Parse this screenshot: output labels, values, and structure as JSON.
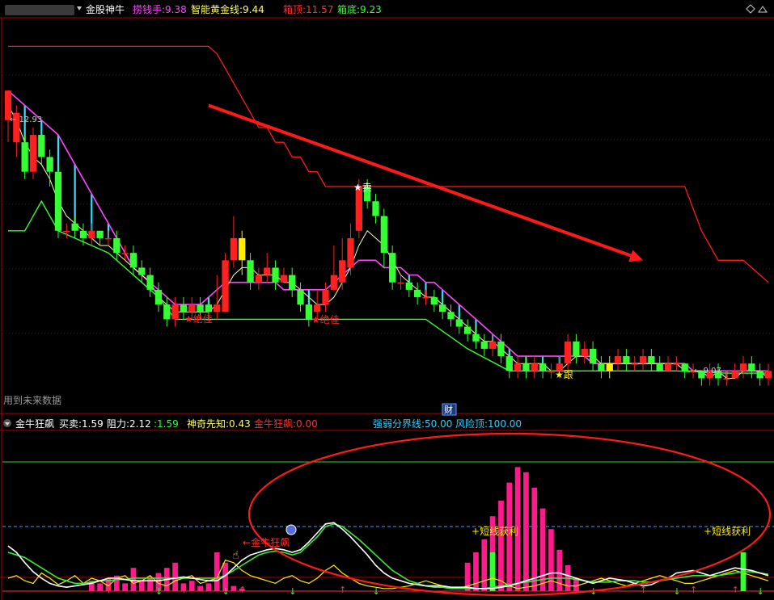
{
  "header": {
    "title": "金股神牛",
    "indicators": [
      {
        "label": "捞钱手:",
        "value": "9.38",
        "color": "#ff44ff"
      },
      {
        "label": "智能黄金线:",
        "value": "9.44",
        "color": "#ffff66"
      },
      {
        "label": "箱顶:",
        "value": "11.57",
        "color": "#ff3030"
      },
      {
        "label": "箱底:",
        "value": "9.23",
        "color": "#33ff33"
      }
    ]
  },
  "main_panel": {
    "high_marker": "12.93",
    "low_marker": "9.07",
    "signals": [
      {
        "text": "★绝佳",
        "color": "#ff2020"
      },
      {
        "text": "★绝佳",
        "color": "#ff2020"
      },
      {
        "text": "★卖",
        "color": "#ffffff"
      },
      {
        "text": "★跟",
        "color": "#ffee00"
      }
    ],
    "future_data_note": "用到未来数据",
    "cai_badge": "财"
  },
  "sub_header": {
    "title": "金牛狂飙",
    "indicators": [
      {
        "label": "买卖:",
        "value": "1.59",
        "color": "#ffffff"
      },
      {
        "label": "阻力:",
        "value": "2.12",
        "color": "#ffffff"
      },
      {
        "label": ":",
        "value": "1.59",
        "color": "#33ff33"
      },
      {
        "label": "神奇先知:",
        "value": "0.43",
        "color": "#ffff66"
      },
      {
        "label": "金牛狂飙:",
        "value": "0.00",
        "color": "#ff3030"
      },
      {
        "label": "强弱分界线:",
        "value": "50.00",
        "color": "#33ccff"
      },
      {
        "label": "风险顶:",
        "value": "100.00",
        "color": "#33ccff"
      }
    ]
  },
  "sub_panel": {
    "labels": [
      {
        "text": "短线获利",
        "color": "#ffee00"
      },
      {
        "text": "短线获利",
        "color": "#ffee00"
      },
      {
        "text": "金牛狂飙",
        "color": "#ff3030"
      }
    ]
  },
  "chart_data": {
    "type": "candlestick",
    "ylim": [
      8.6,
      13.8
    ],
    "candles": [
      [
        12.5,
        12.9,
        12.9,
        12.2
      ],
      [
        12.2,
        12.6,
        12.7,
        12.0
      ],
      [
        12.2,
        11.8,
        12.3,
        11.7
      ],
      [
        11.8,
        12.3,
        12.4,
        11.7
      ],
      [
        12.3,
        12.0,
        12.4,
        11.9
      ],
      [
        12.0,
        11.8,
        12.1,
        11.6
      ],
      [
        11.8,
        11.0,
        11.9,
        10.9
      ],
      [
        11.0,
        11.0,
        11.1,
        10.9
      ],
      [
        11.1,
        11.0,
        11.2,
        10.9
      ],
      [
        11.0,
        10.9,
        11.1,
        10.8
      ],
      [
        10.9,
        11.0,
        11.1,
        10.8
      ],
      [
        11.0,
        10.9,
        11.0,
        10.8
      ],
      [
        10.9,
        10.9,
        11.0,
        10.8
      ],
      [
        10.9,
        10.7,
        11.0,
        10.6
      ],
      [
        10.7,
        10.7,
        10.8,
        10.6
      ],
      [
        10.7,
        10.5,
        10.8,
        10.4
      ],
      [
        10.5,
        10.4,
        10.6,
        10.3
      ],
      [
        10.4,
        10.2,
        10.5,
        10.1
      ],
      [
        10.2,
        10.0,
        10.3,
        9.9
      ],
      [
        10.0,
        9.8,
        10.1,
        9.7
      ],
      [
        9.8,
        10.0,
        10.1,
        9.7
      ],
      [
        10.0,
        9.9,
        10.1,
        9.8
      ],
      [
        9.9,
        10.0,
        10.1,
        9.8
      ],
      [
        10.0,
        9.9,
        10.1,
        9.8
      ],
      [
        10.0,
        9.9,
        10.1,
        9.8
      ],
      [
        9.9,
        10.0,
        10.4,
        9.8
      ],
      [
        9.9,
        10.6,
        10.7,
        9.9
      ],
      [
        10.6,
        10.9,
        11.2,
        10.5
      ],
      [
        10.9,
        10.6,
        11.0,
        10.4
      ],
      [
        10.6,
        10.3,
        10.7,
        10.2
      ],
      [
        10.3,
        10.4,
        10.5,
        10.2
      ],
      [
        10.4,
        10.5,
        10.7,
        10.3
      ],
      [
        10.5,
        10.3,
        10.6,
        10.2
      ],
      [
        10.3,
        10.4,
        10.5,
        10.3
      ],
      [
        10.4,
        10.2,
        10.5,
        10.1
      ],
      [
        10.2,
        10.0,
        10.3,
        9.9
      ],
      [
        10.0,
        9.8,
        10.1,
        9.7
      ],
      [
        9.9,
        10.0,
        10.2,
        9.8
      ],
      [
        10.0,
        10.2,
        10.3,
        9.9
      ],
      [
        10.2,
        10.4,
        10.8,
        10.2
      ],
      [
        10.3,
        10.6,
        10.9,
        10.2
      ],
      [
        10.5,
        10.9,
        11.1,
        10.4
      ],
      [
        11.0,
        11.6,
        11.7,
        10.9
      ],
      [
        11.6,
        11.4,
        11.7,
        11.3
      ],
      [
        11.4,
        11.2,
        11.5,
        11.1
      ],
      [
        11.2,
        10.7,
        11.3,
        10.5
      ],
      [
        10.7,
        10.3,
        10.8,
        10.2
      ],
      [
        10.3,
        10.3,
        10.4,
        10.2
      ],
      [
        10.3,
        10.2,
        10.4,
        10.1
      ],
      [
        10.2,
        10.1,
        10.3,
        10.0
      ],
      [
        10.1,
        10.1,
        10.2,
        10.0
      ],
      [
        10.1,
        10.0,
        10.2,
        9.9
      ],
      [
        10.0,
        9.9,
        10.1,
        9.8
      ],
      [
        9.9,
        9.8,
        10.0,
        9.7
      ],
      [
        9.8,
        9.7,
        9.9,
        9.6
      ],
      [
        9.7,
        9.6,
        9.8,
        9.5
      ],
      [
        9.6,
        9.5,
        9.7,
        9.4
      ],
      [
        9.5,
        9.4,
        9.6,
        9.3
      ],
      [
        9.4,
        9.5,
        9.6,
        9.3
      ],
      [
        9.5,
        9.3,
        9.6,
        9.2
      ],
      [
        9.3,
        9.1,
        9.4,
        9.0
      ],
      [
        9.1,
        9.2,
        9.3,
        9.0
      ],
      [
        9.2,
        9.1,
        9.3,
        9.0
      ],
      [
        9.1,
        9.2,
        9.3,
        9.0
      ],
      [
        9.2,
        9.1,
        9.3,
        9.0
      ],
      [
        9.1,
        9.1,
        9.2,
        9.0
      ],
      [
        9.1,
        9.2,
        9.3,
        9.0
      ],
      [
        9.2,
        9.5,
        9.6,
        9.1
      ],
      [
        9.5,
        9.3,
        9.6,
        9.2
      ],
      [
        9.3,
        9.4,
        9.5,
        9.2
      ],
      [
        9.4,
        9.2,
        9.5,
        9.1
      ],
      [
        9.2,
        9.1,
        9.3,
        9.0
      ],
      [
        9.1,
        9.2,
        9.3,
        9.0
      ],
      [
        9.2,
        9.3,
        9.4,
        9.1
      ],
      [
        9.3,
        9.2,
        9.4,
        9.1
      ],
      [
        9.2,
        9.2,
        9.3,
        9.1
      ],
      [
        9.2,
        9.3,
        9.4,
        9.1
      ],
      [
        9.3,
        9.2,
        9.4,
        9.1
      ],
      [
        9.2,
        9.1,
        9.3,
        9.1
      ],
      [
        9.1,
        9.2,
        9.3,
        9.1
      ],
      [
        9.2,
        9.2,
        9.3,
        9.1
      ],
      [
        9.2,
        9.1,
        9.2,
        9.0
      ],
      [
        9.1,
        9.1,
        9.2,
        9.0
      ],
      [
        9.1,
        9.0,
        9.1,
        8.9
      ],
      [
        9.0,
        9.1,
        9.2,
        8.9
      ],
      [
        9.1,
        9.0,
        9.2,
        8.9
      ],
      [
        9.0,
        9.0,
        9.1,
        8.9
      ],
      [
        9.0,
        9.1,
        9.2,
        9.0
      ],
      [
        9.1,
        9.2,
        9.3,
        9.0
      ],
      [
        9.2,
        9.1,
        9.3,
        9.0
      ],
      [
        9.1,
        9.0,
        9.2,
        8.9
      ],
      [
        9.0,
        9.1,
        9.2,
        8.9
      ]
    ],
    "candle_colors": {
      "up": "#ff2020",
      "down": "#33ff33",
      "highlight": "#ffee00"
    },
    "box_top": [
      13.5,
      13.5,
      13.5,
      13.5,
      13.5,
      13.5,
      13.5,
      13.5,
      13.5,
      13.5,
      13.5,
      13.5,
      13.5,
      13.5,
      13.5,
      13.5,
      13.5,
      13.5,
      13.5,
      13.5,
      13.5,
      13.5,
      13.5,
      13.5,
      13.5,
      13.4,
      13.2,
      13.0,
      12.8,
      12.6,
      12.4,
      12.4,
      12.2,
      12.2,
      12.0,
      12.0,
      11.8,
      11.8,
      11.6,
      11.6,
      11.6,
      11.6,
      11.6,
      11.6,
      11.6,
      11.6,
      11.6,
      11.6,
      11.6,
      11.6,
      11.6,
      11.6,
      11.6,
      11.6,
      11.6,
      11.6,
      11.6,
      11.6,
      11.6,
      11.6,
      11.6,
      11.6,
      11.6,
      11.6,
      11.6,
      11.6,
      11.6,
      11.6,
      11.6,
      11.6,
      11.6,
      11.6,
      11.6,
      11.6,
      11.6,
      11.6,
      11.6,
      11.6,
      11.6,
      11.6,
      11.6,
      11.6,
      11.3,
      11.0,
      10.8,
      10.6,
      10.6,
      10.6,
      10.6,
      10.5,
      10.4,
      10.3
    ],
    "box_bottom_path": [
      [
        0,
        11.0
      ],
      [
        2,
        11.0
      ],
      [
        4,
        11.4
      ],
      [
        6,
        11.0
      ],
      [
        8,
        10.9
      ],
      [
        10,
        10.8
      ],
      [
        12,
        10.7
      ],
      [
        14,
        10.5
      ],
      [
        16,
        10.3
      ],
      [
        18,
        10.1
      ],
      [
        20,
        9.8
      ],
      [
        30,
        9.8
      ],
      [
        40,
        9.8
      ],
      [
        50,
        9.8
      ],
      [
        55,
        9.4
      ],
      [
        60,
        9.1
      ],
      [
        70,
        9.1
      ],
      [
        80,
        9.1
      ],
      [
        86,
        9.07
      ],
      [
        91,
        9.07
      ]
    ],
    "money_line": [
      12.9,
      12.8,
      12.7,
      12.6,
      12.5,
      12.4,
      12.3,
      12.1,
      11.9,
      11.7,
      11.5,
      11.3,
      11.1,
      10.9,
      10.7,
      10.5,
      10.4,
      10.3,
      10.2,
      10.1,
      10.0,
      10.0,
      10.0,
      10.0,
      10.1,
      10.2,
      10.3,
      10.3,
      10.3,
      10.3,
      10.3,
      10.3,
      10.3,
      10.2,
      10.2,
      10.2,
      10.2,
      10.2,
      10.2,
      10.3,
      10.4,
      10.5,
      10.6,
      10.6,
      10.6,
      10.5,
      10.5,
      10.5,
      10.4,
      10.4,
      10.3,
      10.3,
      10.2,
      10.1,
      10.0,
      9.9,
      9.8,
      9.7,
      9.6,
      9.5,
      9.4,
      9.3,
      9.3,
      9.3,
      9.3,
      9.3,
      9.3,
      9.3,
      9.3,
      9.3,
      9.2,
      9.2,
      9.2,
      9.2,
      9.2,
      9.2,
      9.2,
      9.2,
      9.2,
      9.2,
      9.2,
      9.2,
      9.1,
      9.1,
      9.1,
      9.1,
      9.1,
      9.1,
      9.1,
      9.1,
      9.1,
      9.1
    ],
    "golden_line": [
      12.7,
      12.5,
      12.2,
      12.0,
      11.9,
      11.7,
      11.4,
      11.2,
      11.1,
      11.0,
      10.9,
      10.8,
      10.8,
      10.7,
      10.6,
      10.5,
      10.4,
      10.3,
      10.1,
      10.0,
      9.9,
      9.9,
      9.9,
      9.9,
      9.9,
      10.0,
      10.2,
      10.4,
      10.5,
      10.5,
      10.4,
      10.4,
      10.4,
      10.3,
      10.3,
      10.2,
      10.1,
      10.0,
      10.0,
      10.1,
      10.3,
      10.5,
      10.8,
      11.0,
      10.9,
      10.8,
      10.6,
      10.4,
      10.3,
      10.2,
      10.1,
      10.1,
      10.0,
      9.9,
      9.8,
      9.7,
      9.6,
      9.5,
      9.5,
      9.4,
      9.3,
      9.2,
      9.2,
      9.2,
      9.2,
      9.1,
      9.1,
      9.2,
      9.3,
      9.3,
      9.3,
      9.2,
      9.2,
      9.2,
      9.2,
      9.2,
      9.2,
      9.2,
      9.2,
      9.2,
      9.2,
      9.1,
      9.1,
      9.1,
      9.0,
      9.1,
      9.0,
      9.0,
      9.1,
      9.1,
      9.1,
      9.0
    ],
    "trend_arrow": {
      "from": [
        24,
        12.7
      ],
      "to": [
        76,
        10.6
      ]
    },
    "sub_panel": {
      "type": "line",
      "ylim": [
        -5,
        120
      ],
      "strong_weak_line": 50,
      "risk_top": 100,
      "white": [
        35,
        30,
        22,
        15,
        10,
        6,
        4,
        3,
        4,
        5,
        6,
        8,
        10,
        10,
        9,
        8,
        8,
        8,
        8,
        9,
        10,
        11,
        10,
        9,
        8,
        8,
        12,
        18,
        24,
        28,
        30,
        32,
        33,
        32,
        30,
        32,
        38,
        45,
        52,
        53,
        48,
        42,
        35,
        28,
        20,
        14,
        10,
        8,
        6,
        5,
        4,
        4,
        4,
        3,
        3,
        3,
        2,
        2,
        2,
        3,
        4,
        6,
        8,
        10,
        12,
        14,
        14,
        12,
        10,
        8,
        6,
        8,
        10,
        9,
        8,
        6,
        4,
        5,
        8,
        10,
        14,
        15,
        16,
        14,
        12,
        14,
        16,
        18,
        17,
        16,
        14,
        12
      ],
      "green": [
        30,
        28,
        26,
        22,
        18,
        14,
        10,
        8,
        6,
        6,
        7,
        8,
        8,
        9,
        9,
        10,
        10,
        10,
        10,
        10,
        10,
        10,
        10,
        10,
        10,
        10,
        12,
        16,
        20,
        24,
        28,
        30,
        31,
        30,
        28,
        30,
        36,
        42,
        50,
        52,
        50,
        45,
        40,
        34,
        28,
        22,
        16,
        12,
        8,
        6,
        4,
        3,
        3,
        2,
        2,
        2,
        2,
        2,
        3,
        4,
        5,
        6,
        7,
        8,
        9,
        10,
        10,
        10,
        9,
        8,
        7,
        7,
        7,
        8,
        8,
        8,
        7,
        7,
        8,
        9,
        10,
        11,
        12,
        12,
        12,
        12,
        13,
        14,
        15,
        15,
        14,
        13
      ],
      "yellow": [
        10,
        12,
        8,
        6,
        14,
        10,
        5,
        8,
        12,
        6,
        10,
        8,
        4,
        10,
        12,
        6,
        8,
        12,
        6,
        4,
        8,
        10,
        12,
        6,
        8,
        10,
        24,
        22,
        16,
        12,
        10,
        8,
        6,
        10,
        12,
        8,
        6,
        10,
        16,
        20,
        14,
        10,
        6,
        4,
        3,
        2,
        2,
        3,
        4,
        6,
        8,
        6,
        4,
        2,
        2,
        4,
        6,
        8,
        10,
        8,
        4,
        2,
        3,
        4,
        6,
        8,
        6,
        4,
        4,
        6,
        8,
        10,
        8,
        6,
        4,
        6,
        8,
        10,
        12,
        10,
        8,
        6,
        6,
        8,
        10,
        12,
        14,
        16,
        14,
        12,
        10,
        8
      ],
      "pink_bars": [
        0,
        0,
        0,
        0,
        0,
        0,
        0,
        0,
        0,
        0,
        8,
        6,
        10,
        12,
        6,
        18,
        8,
        10,
        14,
        18,
        22,
        6,
        8,
        4,
        6,
        30,
        22,
        4,
        2,
        0,
        0,
        0,
        0,
        0,
        0,
        0,
        0,
        0,
        0,
        0,
        0,
        0,
        0,
        0,
        0,
        0,
        0,
        0,
        0,
        0,
        0,
        0,
        0,
        0,
        0,
        22,
        30,
        40,
        58,
        70,
        84,
        96,
        92,
        80,
        64,
        48,
        32,
        20,
        10,
        0,
        0,
        0,
        0,
        0,
        0,
        0,
        0,
        0,
        0,
        0,
        0,
        0,
        0,
        0,
        0,
        0,
        0,
        0,
        0,
        0,
        0,
        0
      ]
    }
  }
}
